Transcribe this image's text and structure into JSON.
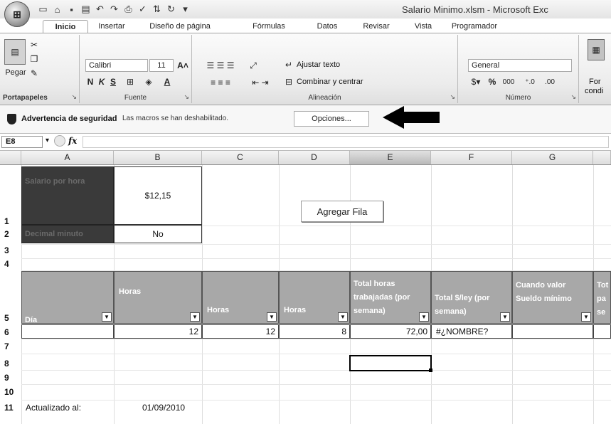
{
  "window": {
    "title": "Salario Minimo.xlsm - Microsoft Exc",
    "office_button": "⊞"
  },
  "quick_access": {
    "icons": [
      "new-icon",
      "open-icon",
      "save-icon",
      "print-preview-icon",
      "undo-icon",
      "redo-icon",
      "print-icon",
      "spellcheck-icon",
      "sort-icon",
      "refresh-icon",
      "customize-icon"
    ]
  },
  "tabs": [
    "Inicio",
    "Insertar",
    "Diseño de página",
    "Fórmulas",
    "Datos",
    "Revisar",
    "Vista",
    "Programador"
  ],
  "ribbon": {
    "clipboard": {
      "paste_label": "Pegar",
      "group_label": "Portapapeles"
    },
    "font": {
      "name": "Calibri",
      "size": "11",
      "bold": "N",
      "italic": "K",
      "underline": "S",
      "group_label": "Fuente"
    },
    "alignment": {
      "wrap_text": "Ajustar texto",
      "merge_center": "Combinar y centrar",
      "group_label": "Alineación"
    },
    "number": {
      "format": "General",
      "percent": "%",
      "thousands": "000",
      "group_label": "Número"
    },
    "styles": {
      "conditional_label_1": "For",
      "conditional_label_2": "condi"
    }
  },
  "security_bar": {
    "title": "Advertencia de seguridad",
    "message": "Las macros se han deshabilitado.",
    "options_button": "Opciones..."
  },
  "formula_bar": {
    "name_box": "E8",
    "fx": "fx",
    "value": ""
  },
  "columns": [
    "A",
    "B",
    "C",
    "D",
    "E",
    "F",
    "G"
  ],
  "rows": [
    "1",
    "2",
    "3",
    "4",
    "5",
    "6",
    "7",
    "8",
    "9",
    "10",
    "11"
  ],
  "cells": {
    "A1": "Salario por hora",
    "B1": "$12,15",
    "A2": "Decimal minuto",
    "B2": "No",
    "D1_button": "Agregar Fila",
    "A5": "Día",
    "B5": "Horas",
    "C5": "Horas",
    "D5": "Horas",
    "E5": "Total horas trabajadas (por semana)",
    "F5": "Total $/ley (por semana)",
    "G5": "Cuando valor Sueldo mínimo",
    "H5": "Tot pa se",
    "B6": "12",
    "C6": "12",
    "D6": "8",
    "E6": "72,00",
    "F6": "#¿NOMBRE?",
    "A11": "Actualizado al:",
    "B11": "01/09/2010"
  },
  "colors": {
    "header_fill": "#a8a8a8",
    "label_fill": "#3a3a3a",
    "selected_col": "#c7b98a"
  }
}
